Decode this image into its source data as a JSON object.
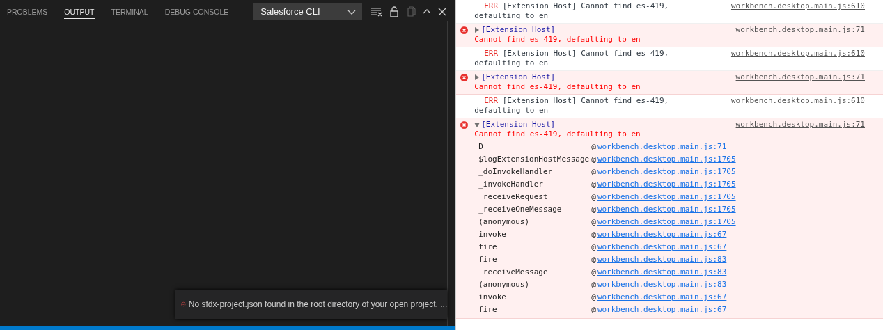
{
  "panel": {
    "tabs": [
      {
        "label": "PROBLEMS",
        "selected": false
      },
      {
        "label": "OUTPUT",
        "selected": true
      },
      {
        "label": "TERMINAL",
        "selected": false
      },
      {
        "label": "DEBUG CONSOLE",
        "selected": false
      }
    ],
    "channel_dropdown": {
      "value": "Salesforce CLI"
    }
  },
  "notification": {
    "text": "No sfdx-project.json found in the root directory of your open project. ..."
  },
  "console": {
    "entries": [
      {
        "kind": "err",
        "level": "ERR",
        "message": "[Extension Host] Cannot find es-419, defaulting to en",
        "source": "workbench.desktop.main.js:610"
      },
      {
        "kind": "error",
        "expanded": false,
        "origin": "[Extension Host]",
        "message": "Cannot find es-419, defaulting to en",
        "source": "workbench.desktop.main.js:71"
      },
      {
        "kind": "err",
        "level": "ERR",
        "message": "[Extension Host] Cannot find es-419, defaulting to en",
        "source": "workbench.desktop.main.js:610"
      },
      {
        "kind": "error",
        "expanded": false,
        "origin": "[Extension Host]",
        "message": "Cannot find es-419, defaulting to en",
        "source": "workbench.desktop.main.js:71"
      },
      {
        "kind": "err",
        "level": "ERR",
        "message": "[Extension Host] Cannot find es-419, defaulting to en",
        "source": "workbench.desktop.main.js:610"
      },
      {
        "kind": "error",
        "expanded": true,
        "origin": "[Extension Host]",
        "message": "Cannot find es-419, defaulting to en",
        "source": "workbench.desktop.main.js:71",
        "children": [
          {
            "fn": "D",
            "at": "@",
            "link": "workbench.desktop.main.js:71"
          },
          {
            "fn": "$logExtensionHostMessage",
            "at": "@",
            "link": "workbench.desktop.main.js:1705"
          },
          {
            "fn": "_doInvokeHandler",
            "at": "@",
            "link": "workbench.desktop.main.js:1705"
          },
          {
            "fn": "_invokeHandler",
            "at": "@",
            "link": "workbench.desktop.main.js:1705"
          },
          {
            "fn": "_receiveRequest",
            "at": "@",
            "link": "workbench.desktop.main.js:1705"
          },
          {
            "fn": "_receiveOneMessage",
            "at": "@",
            "link": "workbench.desktop.main.js:1705"
          },
          {
            "fn": "(anonymous)",
            "at": "@",
            "link": "workbench.desktop.main.js:1705"
          },
          {
            "fn": "invoke",
            "at": "@",
            "link": "workbench.desktop.main.js:67"
          },
          {
            "fn": "fire",
            "at": "@",
            "link": "workbench.desktop.main.js:67"
          },
          {
            "fn": "fire",
            "at": "@",
            "link": "workbench.desktop.main.js:83"
          },
          {
            "fn": "_receiveMessage",
            "at": "@",
            "link": "workbench.desktop.main.js:83"
          },
          {
            "fn": "(anonymous)",
            "at": "@",
            "link": "workbench.desktop.main.js:83"
          },
          {
            "fn": "invoke",
            "at": "@",
            "link": "workbench.desktop.main.js:67"
          },
          {
            "fn": "fire",
            "at": "@",
            "link": "workbench.desktop.main.js:67"
          }
        ]
      }
    ]
  }
}
